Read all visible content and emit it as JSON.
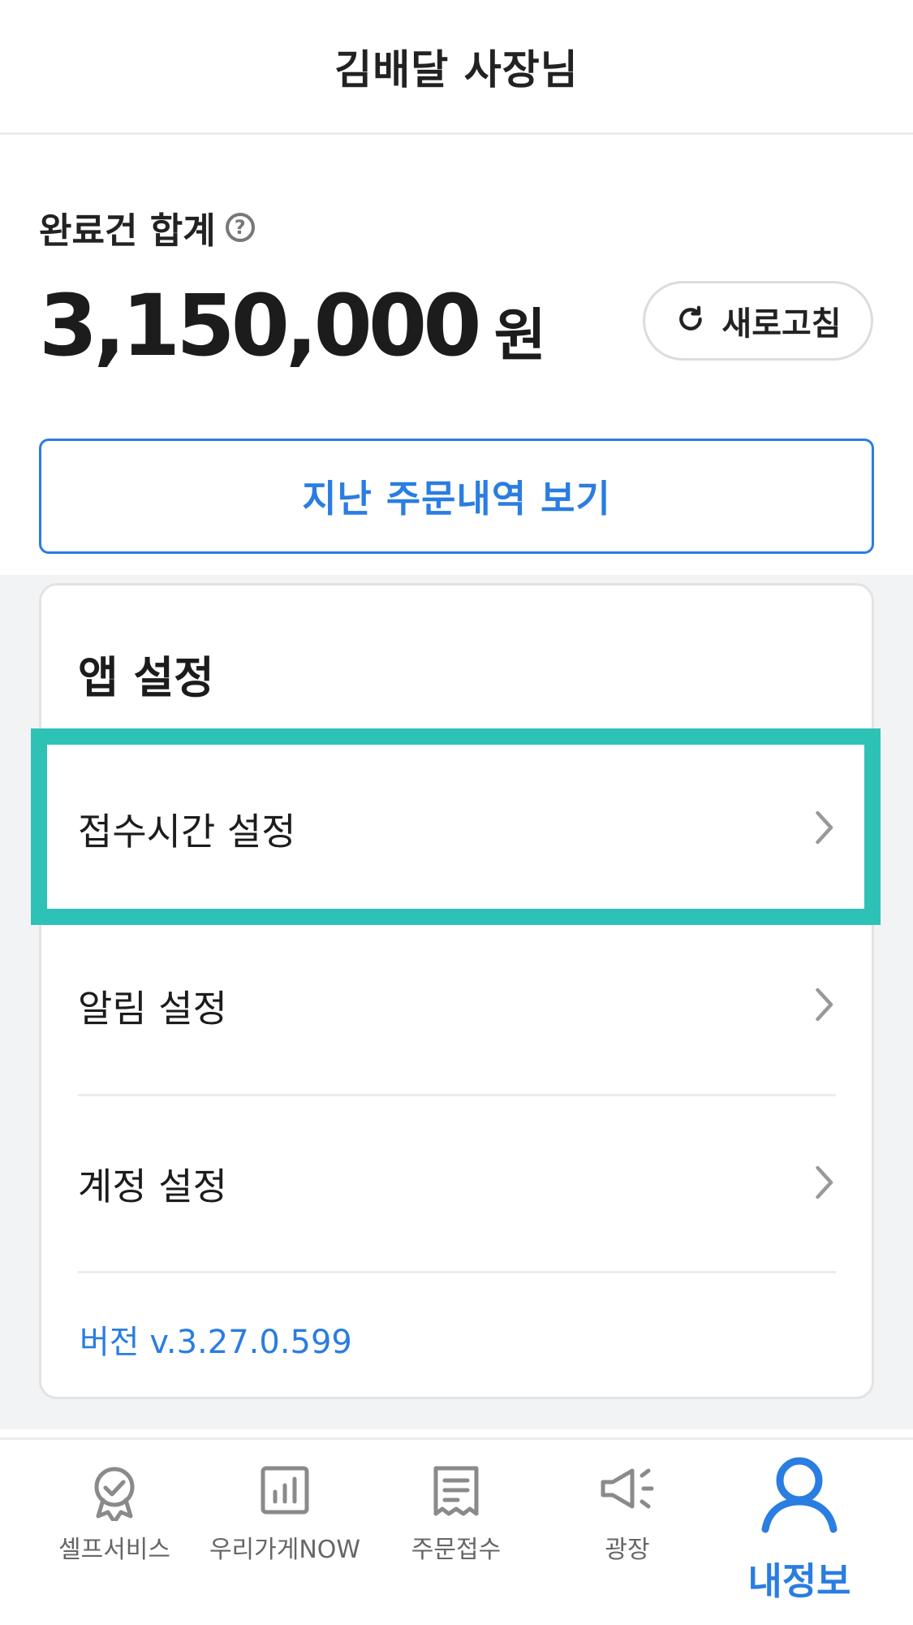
{
  "header": {
    "title": "김배달 사장님"
  },
  "summary": {
    "label": "완료건 합계",
    "help_symbol": "?",
    "amount": "3,150,000",
    "currency": "원",
    "refresh_label": "새로고침"
  },
  "history_button": {
    "label": "지난 주문내역 보기"
  },
  "settings": {
    "title": "앱 설정",
    "items": [
      {
        "label": "접수시간 설정",
        "icon": "chevron-right-icon"
      },
      {
        "label": "알림 설정",
        "icon": "chevron-right-icon"
      },
      {
        "label": "계정 설정",
        "icon": "chevron-right-icon"
      }
    ],
    "version": "버전 v.3.27.0.599"
  },
  "highlight": {
    "color": "#2ec2b6",
    "target": "접수시간 설정"
  },
  "bottom_nav": {
    "items": [
      {
        "label": "셀프서비스",
        "icon": "badge-check-icon",
        "active": false
      },
      {
        "label": "우리가게NOW",
        "icon": "bar-chart-icon",
        "active": false
      },
      {
        "label": "주문접수",
        "icon": "receipt-icon",
        "active": false
      },
      {
        "label": "광장",
        "icon": "megaphone-icon",
        "active": false
      },
      {
        "label": "내정보",
        "icon": "person-icon",
        "active": true
      }
    ]
  },
  "colors": {
    "accent": "#2a7de1",
    "highlight": "#2ec2b6",
    "inactive_icon": "#8a8a8a"
  }
}
